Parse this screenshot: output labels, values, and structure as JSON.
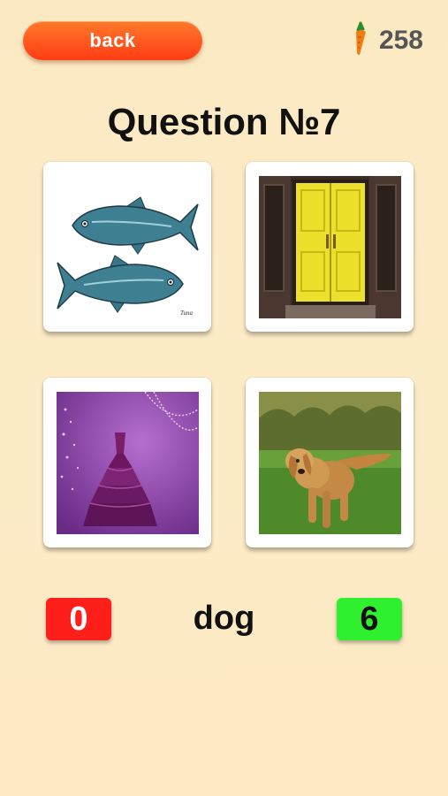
{
  "header": {
    "back_label": "back",
    "carrot_count": "258"
  },
  "question": {
    "title": "Question №7",
    "target_word": "dog"
  },
  "choices": [
    {
      "id": "fish",
      "signature": "Tuna"
    },
    {
      "id": "door"
    },
    {
      "id": "dress"
    },
    {
      "id": "dog"
    }
  ],
  "score": {
    "wrong": "0",
    "right": "6"
  },
  "colors": {
    "back_button": "#ff4e1a",
    "wrong_badge": "#ff1f1a",
    "right_badge": "#2ff02f"
  }
}
